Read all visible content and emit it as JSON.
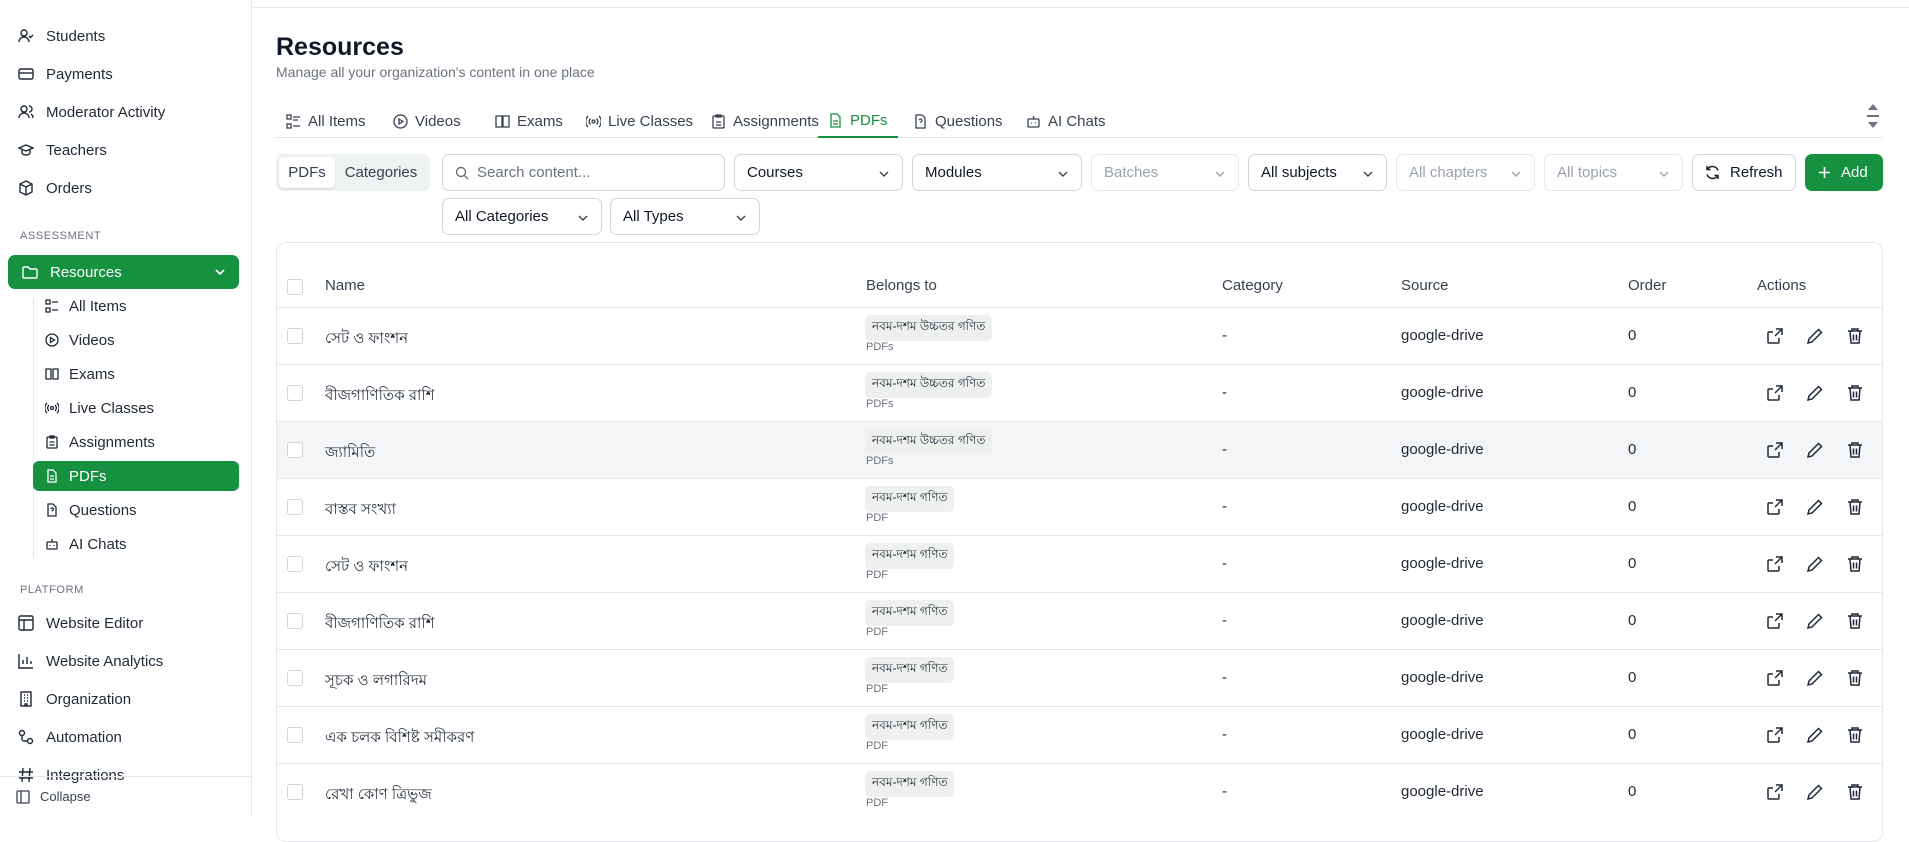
{
  "sidebar": {
    "top_items": [
      {
        "label": "Students",
        "icon": "user-icon"
      },
      {
        "label": "Payments",
        "icon": "card-icon"
      },
      {
        "label": "Moderator Activity",
        "icon": "users-icon"
      },
      {
        "label": "Teachers",
        "icon": "graduation-cap-icon"
      },
      {
        "label": "Orders",
        "icon": "package-icon"
      }
    ],
    "assessment_label": "ASSESSMENT",
    "resources_label": "Resources",
    "sub_items": [
      {
        "label": "All Items"
      },
      {
        "label": "Videos"
      },
      {
        "label": "Exams"
      },
      {
        "label": "Live Classes"
      },
      {
        "label": "Assignments"
      },
      {
        "label": "PDFs"
      },
      {
        "label": "Questions"
      },
      {
        "label": "AI Chats"
      }
    ],
    "platform_label": "PLATFORM",
    "platform_items": [
      {
        "label": "Website Editor"
      },
      {
        "label": "Website Analytics"
      },
      {
        "label": "Organization"
      },
      {
        "label": "Automation"
      },
      {
        "label": "Integrations"
      }
    ],
    "collapse_label": "Collapse"
  },
  "header": {
    "title": "Resources",
    "subtitle": "Manage all your organization's content in one place"
  },
  "tabs": [
    "All Items",
    "Videos",
    "Exams",
    "Live Classes",
    "Assignments",
    "PDFs",
    "Questions",
    "AI Chats"
  ],
  "active_tab": "PDFs",
  "toolbar": {
    "seg_pdfs": "PDFs",
    "seg_categories": "Categories",
    "search_placeholder": "Search content...",
    "courses": "Courses",
    "modules": "Modules",
    "batches": "Batches",
    "subjects": "All subjects",
    "chapters": "All chapters",
    "topics": "All topics",
    "refresh": "Refresh",
    "add": "Add",
    "categories_filter": "All Categories",
    "types_filter": "All Types"
  },
  "table": {
    "headers": {
      "name": "Name",
      "belongs": "Belongs to",
      "category": "Category",
      "source": "Source",
      "order": "Order",
      "actions": "Actions"
    },
    "rows": [
      {
        "name": "সেট ও ফাংশন",
        "badge": "নবম-দশম উচ্চতর গণিত",
        "type": "PDFs",
        "category": "-",
        "source": "google-drive",
        "order": "0"
      },
      {
        "name": "বীজগাণিতিক রাশি",
        "badge": "নবম-দশম উচ্চতর গণিত",
        "type": "PDFs",
        "category": "-",
        "source": "google-drive",
        "order": "0"
      },
      {
        "name": "জ্যামিতি",
        "badge": "নবম-দশম উচ্চতর গণিত",
        "type": "PDFs",
        "category": "-",
        "source": "google-drive",
        "order": "0"
      },
      {
        "name": "বাস্তব সংখ্যা",
        "badge": "নবম-দশম গণিত",
        "type": "PDF",
        "category": "-",
        "source": "google-drive",
        "order": "0"
      },
      {
        "name": "সেট ও ফাংশন",
        "badge": "নবম-দশম গণিত",
        "type": "PDF",
        "category": "-",
        "source": "google-drive",
        "order": "0"
      },
      {
        "name": "বীজগাণিতিক রাশি",
        "badge": "নবম-দশম গণিত",
        "type": "PDF",
        "category": "-",
        "source": "google-drive",
        "order": "0"
      },
      {
        "name": "সূচক ও লগারিদম",
        "badge": "নবম-দশম গণিত",
        "type": "PDF",
        "category": "-",
        "source": "google-drive",
        "order": "0"
      },
      {
        "name": "এক চলক বিশিষ্ট সমীকরণ",
        "badge": "নবম-দশম গণিত",
        "type": "PDF",
        "category": "-",
        "source": "google-drive",
        "order": "0"
      },
      {
        "name": "রেখা কোণ ত্রিভুজ",
        "badge": "নবম-দশম গণিত",
        "type": "PDF",
        "category": "-",
        "source": "google-drive",
        "order": "0"
      }
    ]
  },
  "colors": {
    "accent": "#16913f"
  }
}
